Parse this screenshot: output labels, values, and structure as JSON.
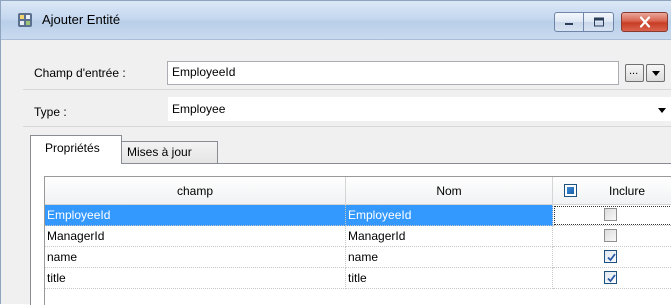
{
  "window": {
    "title": "Ajouter Entité",
    "icon": "app-entity-icon",
    "controls": [
      "minimize-icon",
      "maximize-icon",
      "close-icon"
    ]
  },
  "form": {
    "input_field_label": "Champ d'entrée :",
    "input_field_value": "EmployeeId",
    "ellipsis_label": "...",
    "type_label": "Type :",
    "type_value": "Employee"
  },
  "tabs": [
    {
      "label": "Propriétés",
      "active": true
    },
    {
      "label": "Mises à jour",
      "active": false
    }
  ],
  "grid": {
    "columns": [
      "champ",
      "Nom",
      "Inclure"
    ],
    "rows": [
      {
        "champ": "EmployeeId",
        "nom": "EmployeeId",
        "inclure": false,
        "selected": true
      },
      {
        "champ": "ManagerId",
        "nom": "ManagerId",
        "inclure": false,
        "selected": false
      },
      {
        "champ": "name",
        "nom": "name",
        "inclure": true,
        "selected": false
      },
      {
        "champ": "title",
        "nom": "title",
        "inclure": true,
        "selected": false
      }
    ]
  },
  "colors": {
    "selection": "#3399ff",
    "close_button": "#c83d24",
    "titlebar": "#c5d8ef"
  }
}
